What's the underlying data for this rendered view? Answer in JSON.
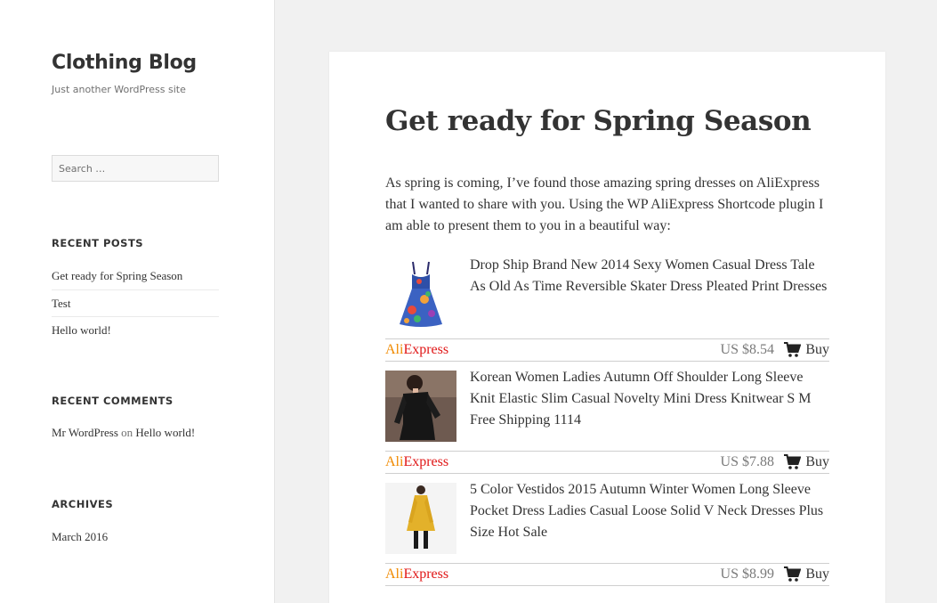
{
  "site": {
    "title": "Clothing Blog",
    "description": "Just another WordPress site"
  },
  "search": {
    "placeholder": "Search …"
  },
  "widgets": {
    "recent_posts": {
      "title": "RECENT POSTS",
      "items": [
        "Get ready for Spring Season",
        "Test",
        "Hello world!"
      ]
    },
    "recent_comments": {
      "title": "RECENT COMMENTS",
      "author": "Mr WordPress",
      "connector": "on",
      "post": "Hello world!"
    },
    "archives": {
      "title": "ARCHIVES",
      "items": [
        "March 2016"
      ]
    }
  },
  "post": {
    "title": "Get ready for Spring Season",
    "intro": "As spring is coming, I’ve found those amazing spring dresses on AliExpress that I wanted to share with you. Using the WP AliExpress Shortcode plugin I am able to present them to you in a beautiful way:"
  },
  "brand": {
    "part1": "Ali",
    "part2": "Express",
    "color1": "#f08a00",
    "color2": "#e01616"
  },
  "buy_label": "Buy",
  "products": [
    {
      "title": "Drop Ship Brand New 2014 Sexy Women Casual Dress Tale As Old As Time Reversible Skater Dress Pleated Print Dresses",
      "price": "US $8.54",
      "thumb_icon": "floral-dress-photo"
    },
    {
      "title": "Korean Women Ladies Autumn Off Shoulder Long Sleeve Knit Elastic Slim Casual Novelty Mini Dress Knitwear S M Free Shipping 1114",
      "price": "US $7.88",
      "thumb_icon": "black-knit-dress-photo"
    },
    {
      "title": "5 Color Vestidos 2015 Autumn Winter Women Long Sleeve Pocket Dress Ladies Casual Loose Solid V Neck Dresses Plus Size Hot Sale",
      "price": "US $8.99",
      "thumb_icon": "yellow-dress-photo"
    }
  ]
}
